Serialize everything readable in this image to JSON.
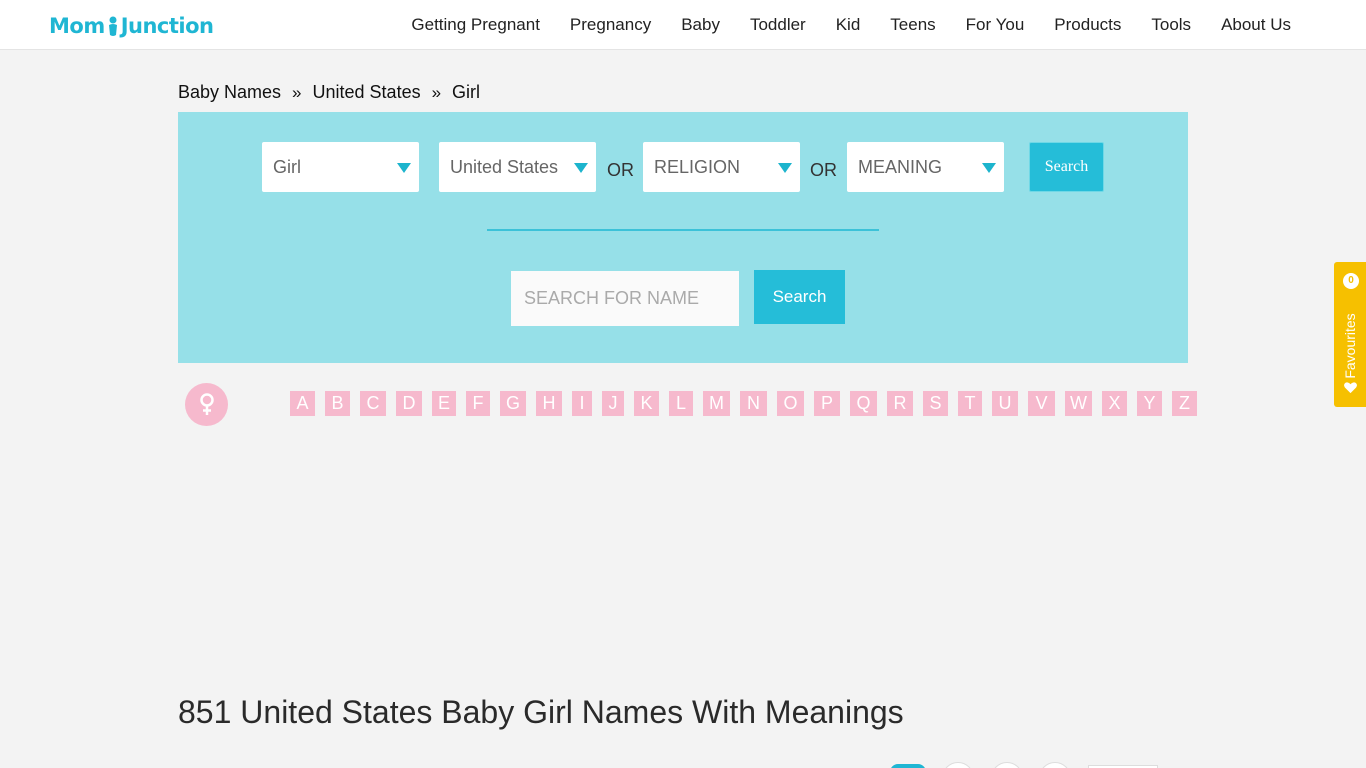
{
  "header": {
    "logo_left": "Mom",
    "logo_right": "Junction",
    "nav": [
      "Getting Pregnant",
      "Pregnancy",
      "Baby",
      "Toddler",
      "Kid",
      "Teens",
      "For You",
      "Products",
      "Tools",
      "About Us"
    ]
  },
  "breadcrumb": {
    "items": [
      "Baby Names",
      "United States",
      "Girl"
    ],
    "separator": "»"
  },
  "search": {
    "gender": "Girl",
    "country": "United States",
    "religion": "RELIGION",
    "meaning": "MEANING",
    "or_label": "OR",
    "search_label": "Search",
    "name_placeholder": "SEARCH FOR NAME",
    "name_search_label": "Search"
  },
  "alphabet": [
    "A",
    "B",
    "C",
    "D",
    "E",
    "F",
    "G",
    "H",
    "I",
    "J",
    "K",
    "L",
    "M",
    "N",
    "O",
    "P",
    "Q",
    "R",
    "S",
    "T",
    "U",
    "V",
    "W",
    "X",
    "Y",
    "Z"
  ],
  "page_title": "851 United States Baby Girl Names With Meanings",
  "favourites": {
    "label": "Favourites",
    "count": "0"
  },
  "colors": {
    "brand": "#1fb6d3",
    "panel": "#96e0e8",
    "button": "#25bdd8",
    "pink": "#f6b9cd",
    "favourites": "#f6c000"
  }
}
